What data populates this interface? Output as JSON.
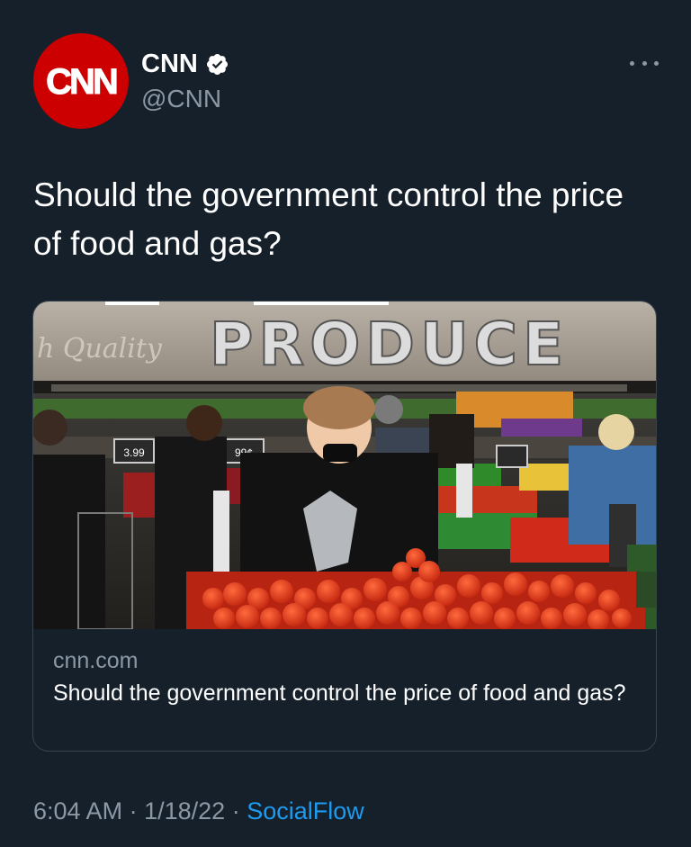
{
  "account": {
    "avatar_text": "CNN",
    "display_name": "CNN",
    "handle": "@CNN",
    "verified": true
  },
  "tweet": {
    "text": "Should the government control the price of food and gas?"
  },
  "card": {
    "image_sign": "PRODUCE",
    "image_script": "h Quality",
    "price_tag_1": "3.99",
    "price_tag_2": "99¢",
    "domain": "cnn.com",
    "title": "Should the government control the price of food and gas?"
  },
  "meta": {
    "time": "6:04 AM",
    "separator": "·",
    "date": "1/18/22",
    "source": "SocialFlow"
  },
  "colors": {
    "background": "#15202b",
    "avatar_red": "#cc0000",
    "secondary_text": "#8b98a5",
    "link_blue": "#1d9bf0",
    "card_border": "#38444d"
  },
  "icons": {
    "verified": "verified-badge-icon",
    "more": "more-horizontal-icon"
  }
}
